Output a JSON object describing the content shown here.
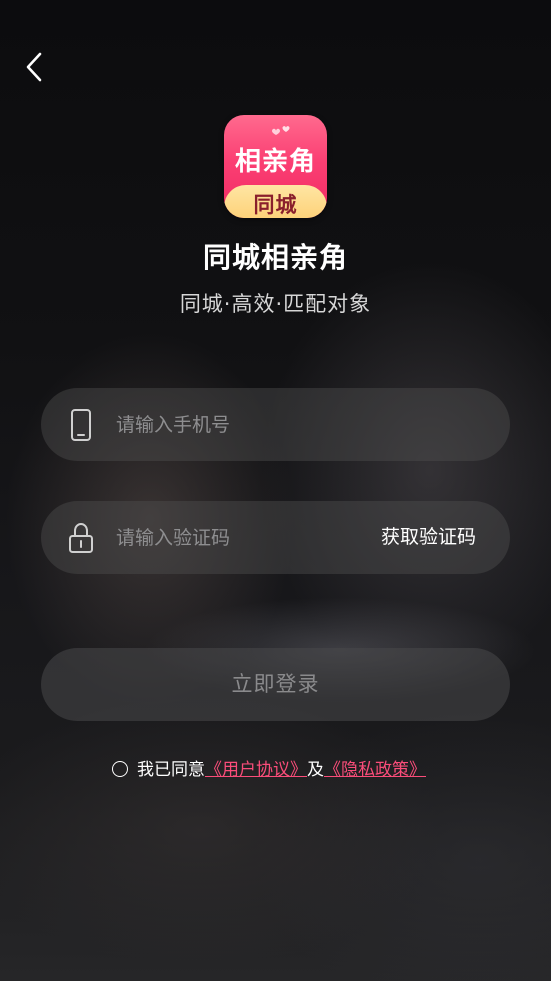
{
  "header": {
    "back_icon": "chevron-left-icon"
  },
  "logo": {
    "top_text": "相亲角",
    "bottom_text": "同城"
  },
  "app": {
    "name": "同城相亲角",
    "slogan": "同城·高效·匹配对象"
  },
  "form": {
    "phone_placeholder": "请输入手机号",
    "phone_value": "",
    "phone_icon": "phone-icon",
    "code_placeholder": "请输入验证码",
    "code_value": "",
    "code_icon": "lock-icon",
    "get_code_label": "获取验证码",
    "login_label": "立即登录"
  },
  "agreement": {
    "prefix": "我已同意",
    "user_agreement": "《用户协议》",
    "conjunction": "及",
    "privacy_policy": "《隐私政策》"
  },
  "colors": {
    "accent": "#fb4d7a",
    "logo_pink": "#fb3f73",
    "logo_gold": "#fdd27a"
  }
}
